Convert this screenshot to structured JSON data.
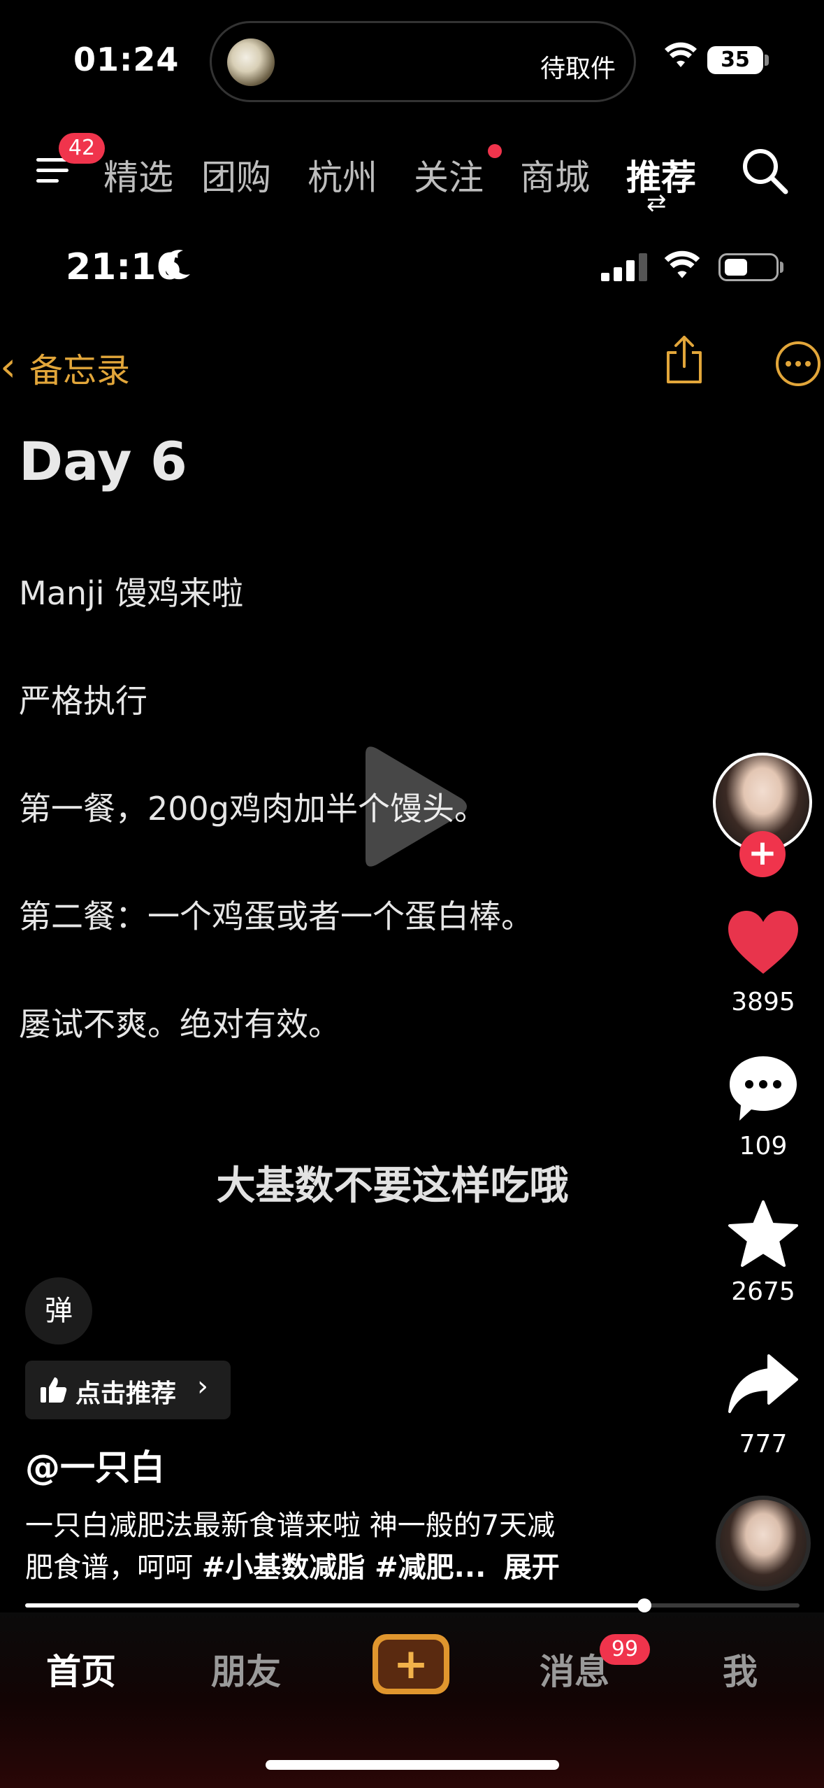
{
  "status_bar": {
    "time": "01:24",
    "island_label": "待取件",
    "battery": "35"
  },
  "top_nav": {
    "menu_badge": "42",
    "tabs": [
      {
        "label": "精选",
        "active": false
      },
      {
        "label": "团购",
        "active": false
      },
      {
        "label": "杭州",
        "active": false
      },
      {
        "label": "关注",
        "active": false,
        "dot": true
      },
      {
        "label": "商城",
        "active": false
      },
      {
        "label": "推荐",
        "active": true
      }
    ]
  },
  "video": {
    "inner_status_time": "21:16",
    "notes_back_label": "备忘录",
    "note_title": "Day 6",
    "note_lines": [
      "Manji 馒鸡来啦",
      "严格执行",
      "第一餐，200g鸡肉加半个馒头。",
      "第二餐：一个鸡蛋或者一个蛋白棒。",
      "屡试不爽。绝对有效。"
    ],
    "subtitle": "大基数不要这样吃哦"
  },
  "side_rail": {
    "likes": "3895",
    "comments": "109",
    "favorites": "2675",
    "shares": "777",
    "follow_symbol": "+"
  },
  "info": {
    "danmaku_label": "弹",
    "recommend_label": "点击推荐",
    "author": "@一只白",
    "desc_line1": "一只白减肥法最新食谱来啦 神一般的7天减",
    "desc_line2_text": "肥食谱，呵呵 ",
    "desc_tags": "#小基数减脂 #减肥...",
    "expand_label": "展开",
    "progress": 0.8
  },
  "bottom_tabs": {
    "home": "首页",
    "friends": "朋友",
    "create": "+",
    "messages": "消息",
    "messages_badge": "99",
    "me": "我"
  },
  "colors": {
    "accent_red": "#f0344c",
    "notes_gold": "#e2a63a",
    "like_red": "#e8344c"
  }
}
